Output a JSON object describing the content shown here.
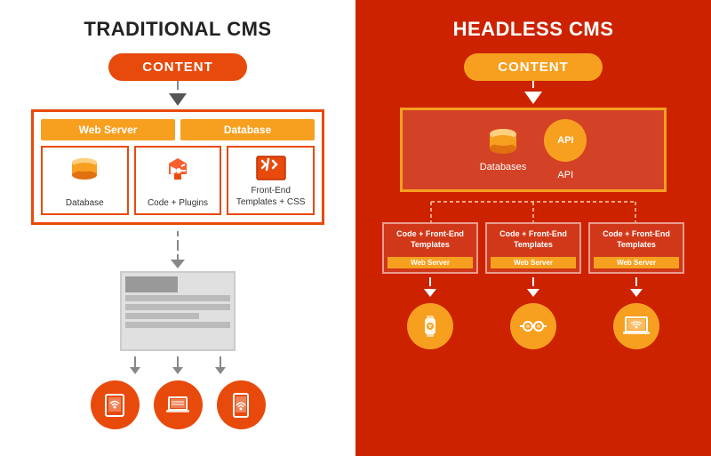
{
  "left": {
    "title": "TRADITIONAL CMS",
    "content_label": "CONTENT",
    "web_server_label": "Web Server",
    "database_label": "Database",
    "icons": [
      {
        "label": "Database"
      },
      {
        "label": "Code + Plugins"
      },
      {
        "label": "Front-End\nTemplates + CSS"
      }
    ],
    "devices": [
      "tablet",
      "laptop",
      "phone"
    ]
  },
  "right": {
    "title": "HEADLESS CMS",
    "content_label": "CONTENT",
    "db_label": "Databases",
    "api_label": "API",
    "server_boxes": [
      {
        "top": "Code + Front-End\nTemplates",
        "bottom": "Web Server"
      },
      {
        "top": "Code + Front-End\nTemplates",
        "bottom": "Web Server"
      },
      {
        "top": "Code + Front-End\nTemplates",
        "bottom": "Web Server"
      }
    ],
    "devices": [
      "smartwatch",
      "ar-glasses",
      "laptop"
    ]
  }
}
